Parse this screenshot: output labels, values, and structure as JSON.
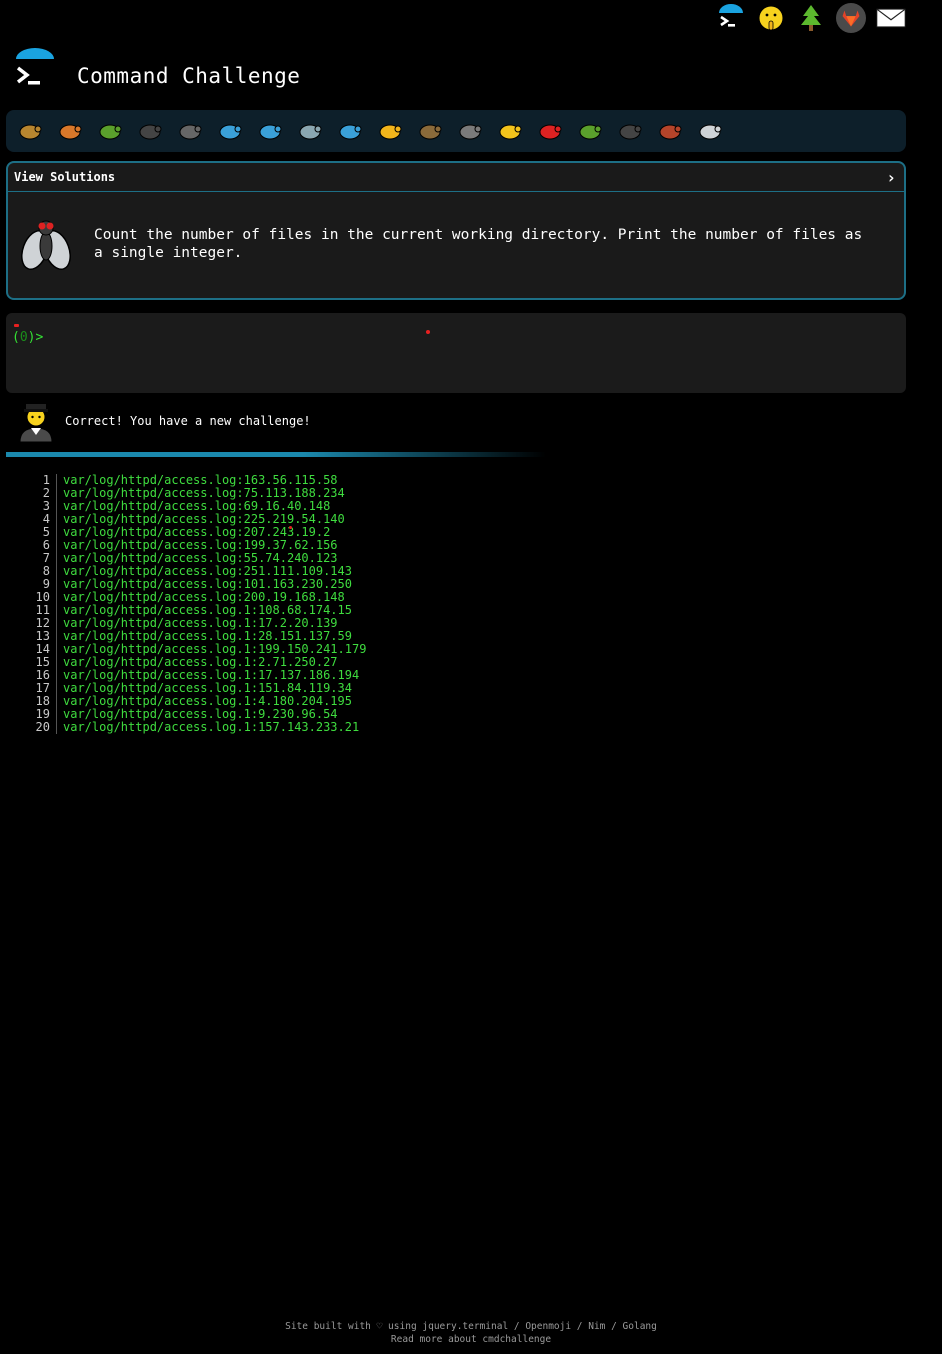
{
  "header": {
    "title": "Command Challenge"
  },
  "top_icons": [
    "terminal-logo-icon",
    "shushing-face-icon",
    "tree-icon",
    "gitlab-icon",
    "envelope-icon"
  ],
  "bug_bar": {
    "items": [
      "snail",
      "butterfly",
      "caterpillar",
      "ant",
      "spider-web",
      "whale",
      "dolphin",
      "shark",
      "fish",
      "tropical-fish",
      "blowfish",
      "wolf",
      "bee",
      "ladybug",
      "worm",
      "mosquito",
      "scorpion",
      "fly"
    ]
  },
  "challenge": {
    "header_label": "View Solutions",
    "chevron": "›",
    "description": "Count the number of files in the current working directory. Print the number of files as a single integer."
  },
  "terminal": {
    "prompt_open": "(",
    "prompt_zero": "0",
    "prompt_close": ")>"
  },
  "message": {
    "text": "Correct! You have a new challenge!"
  },
  "output": {
    "lines": [
      {
        "n": "1",
        "t": "var/log/httpd/access.log:163.56.115.58"
      },
      {
        "n": "2",
        "t": "var/log/httpd/access.log:75.113.188.234"
      },
      {
        "n": "3",
        "t": "var/log/httpd/access.log:69.16.40.148"
      },
      {
        "n": "4",
        "t": "var/log/httpd/access.log:225.219.54.140"
      },
      {
        "n": "5",
        "t": "var/log/httpd/access.log:207.243.19.2"
      },
      {
        "n": "6",
        "t": "var/log/httpd/access.log:199.37.62.156"
      },
      {
        "n": "7",
        "t": "var/log/httpd/access.log:55.74.240.123"
      },
      {
        "n": "8",
        "t": "var/log/httpd/access.log:251.111.109.143"
      },
      {
        "n": "9",
        "t": "var/log/httpd/access.log:101.163.230.250"
      },
      {
        "n": "10",
        "t": "var/log/httpd/access.log:200.19.168.148"
      },
      {
        "n": "11",
        "t": "var/log/httpd/access.log.1:108.68.174.15"
      },
      {
        "n": "12",
        "t": "var/log/httpd/access.log.1:17.2.20.139"
      },
      {
        "n": "13",
        "t": "var/log/httpd/access.log.1:28.151.137.59"
      },
      {
        "n": "14",
        "t": "var/log/httpd/access.log.1:199.150.241.179"
      },
      {
        "n": "15",
        "t": "var/log/httpd/access.log.1:2.71.250.27"
      },
      {
        "n": "16",
        "t": "var/log/httpd/access.log.1:17.137.186.194"
      },
      {
        "n": "17",
        "t": "var/log/httpd/access.log.1:151.84.119.34"
      },
      {
        "n": "18",
        "t": "var/log/httpd/access.log.1:4.180.204.195"
      },
      {
        "n": "19",
        "t": "var/log/httpd/access.log.1:9.230.96.54"
      },
      {
        "n": "20",
        "t": "var/log/httpd/access.log.1:157.143.233.21"
      }
    ]
  },
  "footer": {
    "line1": "Site built with ♡ using jquery.terminal / Openmoji / Nim / Golang",
    "line2": "Read more about cmdchallenge"
  }
}
